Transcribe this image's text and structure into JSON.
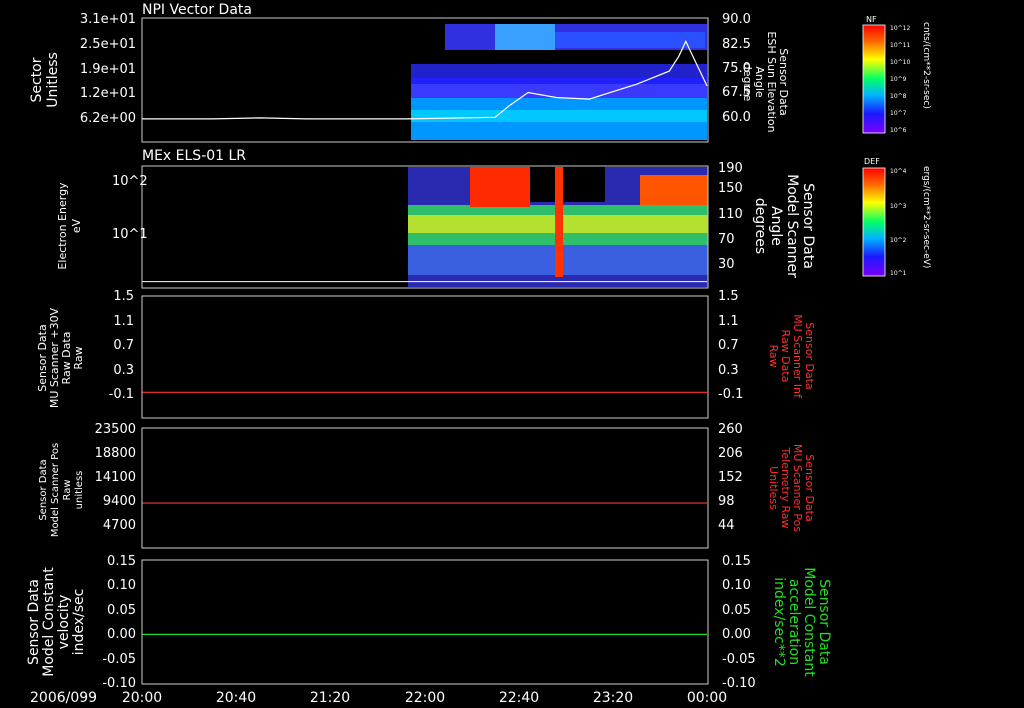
{
  "date_label": "2006/099",
  "x_ticks": [
    "20:00",
    "20:40",
    "21:20",
    "22:00",
    "22:40",
    "23:20",
    "00:00"
  ],
  "colorbars": [
    {
      "title": "NF",
      "unit": "cnts/(cm**2-sr-sec)",
      "ticks": [
        "10^12",
        "10^11",
        "10^10",
        "10^9",
        "10^8",
        "10^7",
        "10^6"
      ]
    },
    {
      "title": "DEF",
      "unit": "ergs/(cm**2-sr-sec-eV)",
      "ticks": [
        "10^4",
        "10^3",
        "10^2",
        "10^1"
      ]
    }
  ],
  "colors": {
    "white": "#ffffff",
    "red": "#ff3030",
    "green": "#22dd22",
    "frame": "#cccccc"
  },
  "chart_data": [
    {
      "type": "heatmap",
      "title": "NPI Vector Data",
      "ylabel": [
        "Sector",
        "Unitless"
      ],
      "ylabel_right": [
        "Sensor Data",
        "ESH Sun Elevation",
        "Angle",
        "degree"
      ],
      "yticks_left": [
        "3.1e+01",
        "2.5e+01",
        "1.9e+01",
        "1.2e+01",
        "6.2e+00"
      ],
      "yticks_right": [
        "90.0",
        "82.5",
        "75.0",
        "67.5",
        "60.0"
      ],
      "ylim_right": [
        53.6,
        90
      ],
      "data_start_time": "21:53",
      "overlay_line": {
        "name": "ESH Sun Elevation Angle",
        "x": [
          "20:00",
          "20:30",
          "20:50",
          "21:10",
          "21:30",
          "21:52",
          "22:30",
          "22:36",
          "22:44",
          "22:56",
          "23:10",
          "23:30",
          "23:44",
          "23:48",
          "23:51",
          "23:56",
          "24:00"
        ],
        "y": [
          60.0,
          60.0,
          60.3,
          60.0,
          60.0,
          60.0,
          60.5,
          64.0,
          68.0,
          66.5,
          66.0,
          70.5,
          74.5,
          79.0,
          83.5,
          76.0,
          70.0
        ]
      }
    },
    {
      "type": "heatmap",
      "title": "MEx ELS-01 LR",
      "ylabel": [
        "Electron Energy",
        "eV"
      ],
      "ylabel_right": [
        "Sensor Data",
        "Model Scanner",
        "Angle",
        "degrees"
      ],
      "yticks_left": [
        "10^2",
        "10^1"
      ],
      "yticks_right": [
        "190",
        "150",
        "110",
        "70",
        "30"
      ],
      "ylim_right": [
        0,
        190
      ],
      "data_start_time": "21:53",
      "overlay_line": {
        "name": "Model Scanner Angle",
        "x": [
          "20:00",
          "24:00"
        ],
        "y": [
          10,
          10
        ]
      }
    },
    {
      "type": "line",
      "ylabel": [
        "Sensor Data",
        "MU Scanner +30V",
        "Raw Data",
        "Raw"
      ],
      "ylabel_right": [
        "Sensor Data",
        "MU Scanner Inf",
        "Raw Data",
        "Raw"
      ],
      "yticks_left": [
        "1.5",
        "1.1",
        "0.7",
        "0.3",
        "-0.1"
      ],
      "yticks_right": [
        "1.5",
        "1.1",
        "0.7",
        "0.3",
        "-0.1"
      ],
      "ylim": [
        -0.4,
        1.5
      ],
      "series": [
        {
          "x": [
            "20:00",
            "24:00"
          ],
          "y": [
            0.0,
            0.0
          ]
        }
      ]
    },
    {
      "type": "line",
      "ylabel": [
        "Sensor Data",
        "Model Scanner Pos",
        "Raw",
        "unitless"
      ],
      "ylabel_right": [
        "Sensor Data",
        "MU Scanner Pos",
        "Telemetry Raw",
        "Unitless"
      ],
      "yticks_left": [
        "23500",
        "18800",
        "14100",
        "9400",
        "4700"
      ],
      "yticks_right": [
        "260",
        "206",
        "152",
        "98",
        "44"
      ],
      "ylim": [
        0,
        23500
      ],
      "series": [
        {
          "x": [
            "20:00",
            "24:00"
          ],
          "y": [
            8800,
            8800
          ]
        }
      ]
    },
    {
      "type": "line",
      "ylabel": [
        "Sensor Data",
        "Model Constant",
        "velocity",
        "index/sec"
      ],
      "ylabel_right": [
        "Sensor Data",
        "Model Constant",
        "acceleration",
        "index/sec**2"
      ],
      "yticks_left": [
        "0.15",
        "0.10",
        "0.05",
        "0.00",
        "-0.05",
        "-0.10"
      ],
      "yticks_right": [
        "0.15",
        "0.10",
        "0.05",
        "0.00",
        "-0.05",
        "-0.10"
      ],
      "ylim": [
        -0.1,
        0.15
      ],
      "series": [
        {
          "x": [
            "20:00",
            "24:00"
          ],
          "y": [
            0.0,
            0.0
          ]
        }
      ]
    }
  ]
}
